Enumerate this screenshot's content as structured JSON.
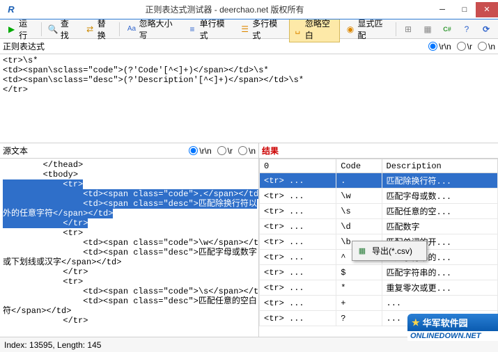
{
  "titlebar": {
    "icon": "R",
    "title": "正则表达式测试器 - deerchao.net 版权所有"
  },
  "toolbar": {
    "run": "运行",
    "find": "查找",
    "replace": "替换",
    "ignoreCase": "忽略大小写",
    "singleLine": "单行模式",
    "multiLine": "多行模式",
    "ignoreSpace": "忽略空白",
    "explicitMatch": "显式匹配"
  },
  "regex": {
    "label": "正则表达式",
    "radio_rn": "\\r\\n",
    "radio_r": "\\r",
    "radio_n": "\\n",
    "value": "<tr>\\s*\n<td><span\\sclass=\"code\">(?'Code'[^<]+)</span></td>\\s*\n<td><span\\sclass=\"desc\">(?'Description'[^<]+)</span></td>\\s*\n</tr>"
  },
  "source": {
    "label": "源文本",
    "content_lines": [
      "        </thead>",
      "        <tbody>",
      "            <tr>",
      "                <td><span class=\"code\">.</span></td>",
      "                <td><span class=\"desc\">匹配除换行符以",
      "外的任意字符</span></td>",
      "            </tr>",
      "            <tr>",
      "                <td><span class=\"code\">\\w</span></td>",
      "                <td><span class=\"desc\">匹配字母或数字",
      "或下划线或汉字</span></td>",
      "            </tr>",
      "            <tr>",
      "                <td><span class=\"code\">\\s</span></td>",
      "                <td><span class=\"desc\">匹配任意的空白",
      "符</span></td>",
      "            </tr>"
    ]
  },
  "results": {
    "label": "结果",
    "headers": {
      "c0": "0",
      "c1": "Code",
      "c2": "Description"
    },
    "rows": [
      {
        "c0": "<tr> ...",
        "c1": ".",
        "c2": "匹配除换行符...",
        "sel": true
      },
      {
        "c0": "<tr> ...",
        "c1": "\\w",
        "c2": "匹配字母或数..."
      },
      {
        "c0": "<tr> ...",
        "c1": "\\s",
        "c2": "匹配任意的空..."
      },
      {
        "c0": "<tr> ...",
        "c1": "\\d",
        "c2": "匹配数字"
      },
      {
        "c0": "<tr> ...",
        "c1": "\\b",
        "c2": "匹配单词的开..."
      },
      {
        "c0": "<tr> ...",
        "c1": "^",
        "c2": "匹配字符串的..."
      },
      {
        "c0": "<tr> ...",
        "c1": "$",
        "c2": "匹配字符串的..."
      },
      {
        "c0": "<tr> ...",
        "c1": "*",
        "c2": "重复零次或更..."
      },
      {
        "c0": "<tr> ...",
        "c1": "+",
        "c2": "..."
      },
      {
        "c0": "<tr> ...",
        "c1": "?",
        "c2": "..."
      }
    ]
  },
  "contextMenu": {
    "exportCsv": "导出(*.csv)"
  },
  "statusbar": {
    "text": "Index: 13595, Length: 145"
  },
  "watermark": {
    "t1": "华军软件园",
    "t2": "ONLINEDOWN.NET"
  }
}
